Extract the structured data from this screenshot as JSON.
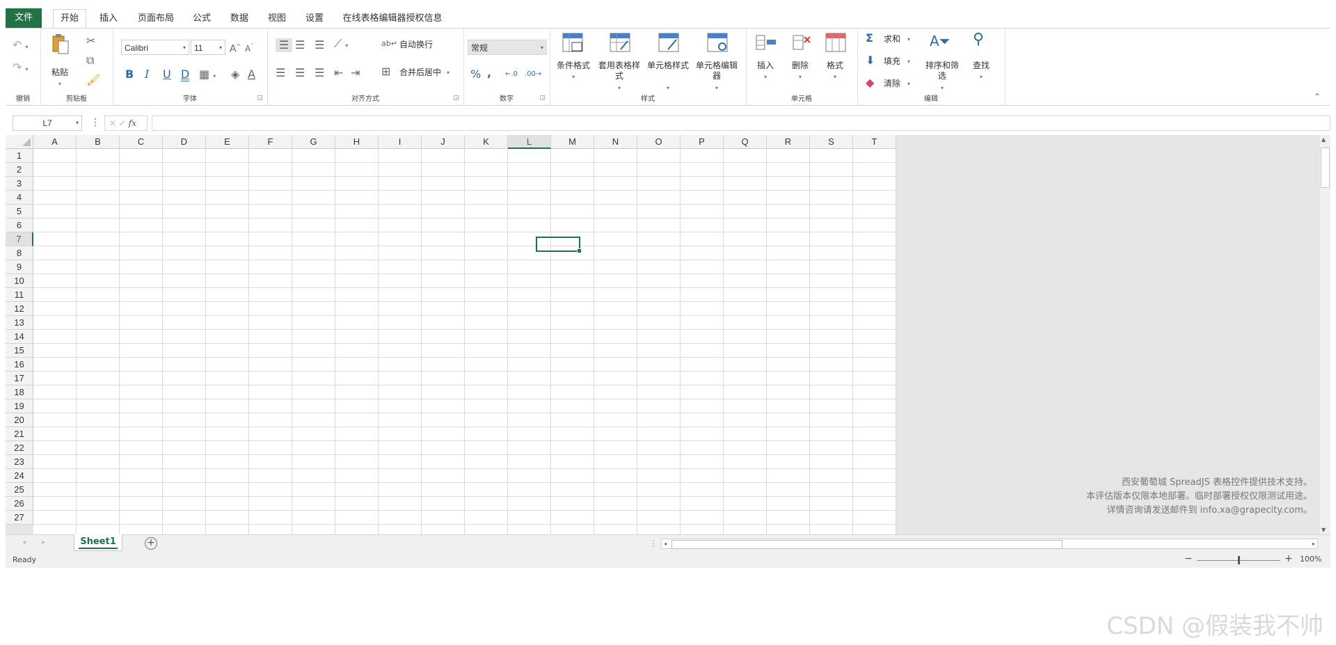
{
  "menu": {
    "file": "文件",
    "tabs": [
      "开始",
      "插入",
      "页面布局",
      "公式",
      "数据",
      "视图",
      "设置",
      "在线表格编辑器授权信息"
    ]
  },
  "ribbon": {
    "undo_group": {
      "label": "撤销"
    },
    "clipboard": {
      "paste": "粘贴",
      "label": "剪贴板"
    },
    "font": {
      "family": "Calibri",
      "size": "11",
      "label": "字体"
    },
    "alignment": {
      "wrap": "自动换行",
      "merge": "合并后居中",
      "label": "对齐方式"
    },
    "number": {
      "format": "常规",
      "label": "数字"
    },
    "styles": {
      "conditional": "条件格式",
      "table_style": "套用表格样式",
      "cell_style": "单元格样式",
      "cell_editor": "单元格编辑器",
      "label": "样式"
    },
    "cells": {
      "insert": "插入",
      "delete": "删除",
      "format": "格式",
      "label": "单元格"
    },
    "editing": {
      "sum": "求和",
      "fill": "填充",
      "clear": "清除",
      "sort": "排序和筛选",
      "find": "查找",
      "label": "编辑"
    }
  },
  "formula_bar": {
    "name_box": "L7",
    "fx": "fx",
    "cancel": "×",
    "confirm": "✓"
  },
  "grid": {
    "columns": [
      "A",
      "B",
      "C",
      "D",
      "E",
      "F",
      "G",
      "H",
      "I",
      "J",
      "K",
      "L",
      "M",
      "N",
      "O",
      "P",
      "Q",
      "R",
      "S",
      "T"
    ],
    "rows": [
      "1",
      "2",
      "3",
      "4",
      "5",
      "6",
      "7",
      "8",
      "9",
      "10",
      "11",
      "12",
      "13",
      "14",
      "15",
      "16",
      "17",
      "18",
      "19",
      "20",
      "21",
      "22",
      "23",
      "24",
      "25",
      "26",
      "27"
    ],
    "selected_col": "L",
    "selected_row": "7"
  },
  "watermark": [
    "西安葡萄城 SpreadJS 表格控件提供技术支持。",
    "本评估版本仅限本地部署。临时部署授权仅限测试用途。",
    "详情咨询请发送邮件到 info.xa@grapecity.com。"
  ],
  "sheets": {
    "tabs": [
      "Sheet1"
    ],
    "add": "⊕"
  },
  "status": {
    "text": "Ready",
    "zoom": "100%"
  },
  "overlay": {
    "csdn": "CSDN @假装我不帅"
  },
  "colors": {
    "accent": "#217346",
    "blue": "#2b6cb0"
  }
}
